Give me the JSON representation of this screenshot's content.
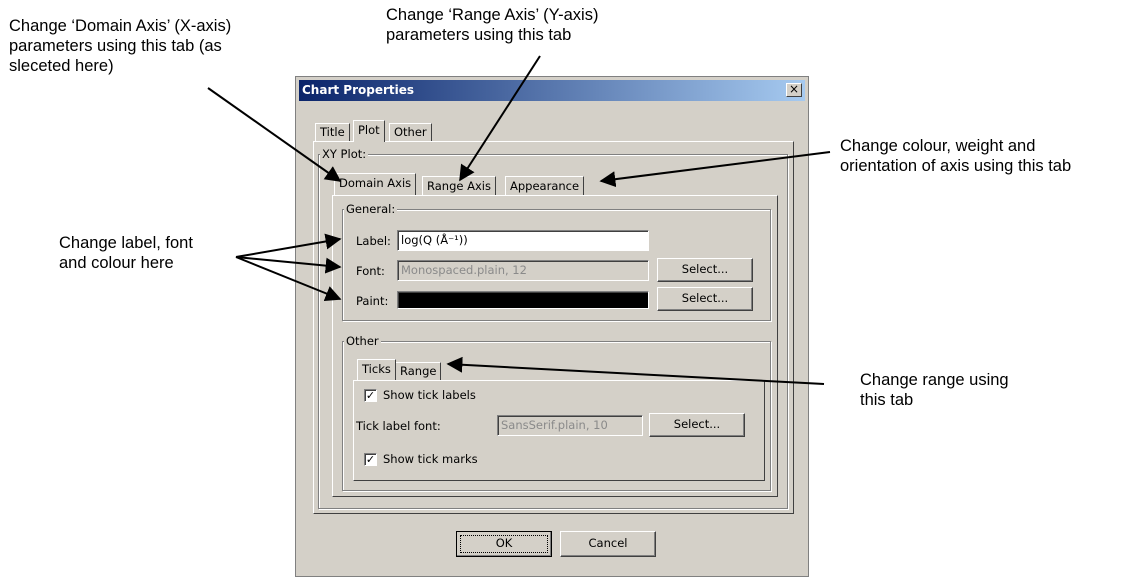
{
  "annotations": {
    "domain_tab": "Change ‘Domain Axis’ (X-axis)\nparameters using this tab (as\nsleceted here)",
    "range_tab": "Change ‘Range Axis’ (Y-axis)\nparameters using this tab",
    "appearance_tab": "Change colour, weight and\norientation of axis using this tab",
    "label_font_colour": "Change label, font\nand colour here",
    "range_subtab": "Change range using\nthis tab"
  },
  "dialog": {
    "title": "Chart Properties",
    "close_glyph": "×",
    "top_tabs": [
      "Title",
      "Plot",
      "Other"
    ],
    "xy_plot_label": "XY Plot:",
    "axis_tabs": [
      "Domain Axis",
      "Range Axis",
      "Appearance"
    ],
    "general": {
      "group_label": "General:",
      "label_caption": "Label:",
      "label_value": "log(Q (Å⁻¹))",
      "font_caption": "Font:",
      "font_value": "Monospaced.plain, 12",
      "font_select": "Select...",
      "paint_caption": "Paint:",
      "paint_color": "#000000",
      "paint_select": "Select..."
    },
    "other": {
      "group_label": "Other",
      "tabs": [
        "Ticks",
        "Range"
      ],
      "show_tick_labels": "Show tick labels",
      "tick_label_font_caption": "Tick label font:",
      "tick_label_font_value": "SansSerif.plain, 10",
      "tick_font_select": "Select...",
      "show_tick_marks": "Show tick marks",
      "check_glyph": "✓"
    },
    "ok": "OK",
    "cancel": "Cancel"
  }
}
